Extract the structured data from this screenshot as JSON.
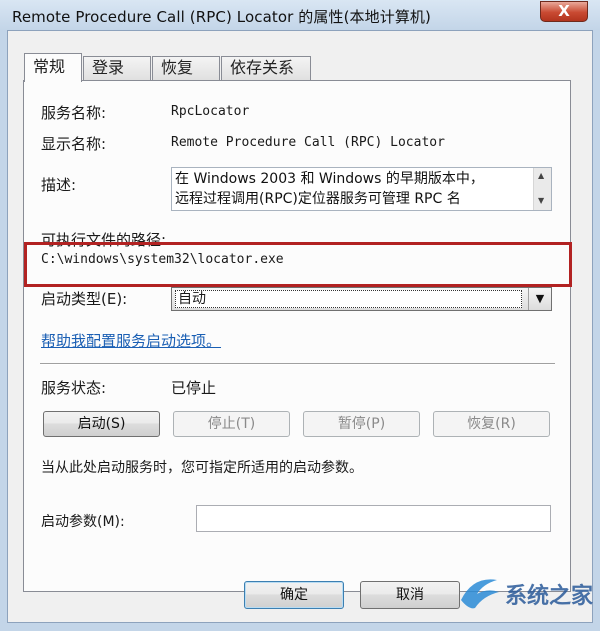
{
  "window": {
    "title": "Remote Procedure Call (RPC) Locator 的属性(本地计算机)",
    "close_label": "X"
  },
  "tabs": [
    {
      "label": "常规",
      "active": true
    },
    {
      "label": "登录",
      "active": false
    },
    {
      "label": "恢复",
      "active": false
    },
    {
      "label": "依存关系",
      "active": false
    }
  ],
  "general": {
    "service_name_label": "服务名称:",
    "service_name": "RpcLocator",
    "display_name_label": "显示名称:",
    "display_name": "Remote Procedure Call (RPC) Locator",
    "description_label": "描述:",
    "description": "在 Windows 2003 和 Windows 的早期版本中，\n远程过程调用(RPC)定位器服务可管理 RPC 名",
    "exec_path_label": "可执行文件的路径:",
    "exec_path": "C:\\windows\\system32\\locator.exe",
    "startup_type_label": "启动类型(E):",
    "startup_type_value": "自动",
    "help_link": "帮助我配置服务启动选项。",
    "service_status_label": "服务状态:",
    "service_status": "已停止",
    "start_button": "启动(S)",
    "stop_button": "停止(T)",
    "pause_button": "暂停(P)",
    "resume_button": "恢复(R)",
    "start_params_hint": "当从此处启动服务时，您可指定所适用的启动参数。",
    "start_params_label": "启动参数(M):",
    "start_params_value": ""
  },
  "footer": {
    "ok_button": "确定",
    "cancel_button": "取消"
  },
  "watermark": {
    "text": "系统之家"
  },
  "colors": {
    "highlight_border": "#b22222",
    "link": "#1a5fb4"
  }
}
